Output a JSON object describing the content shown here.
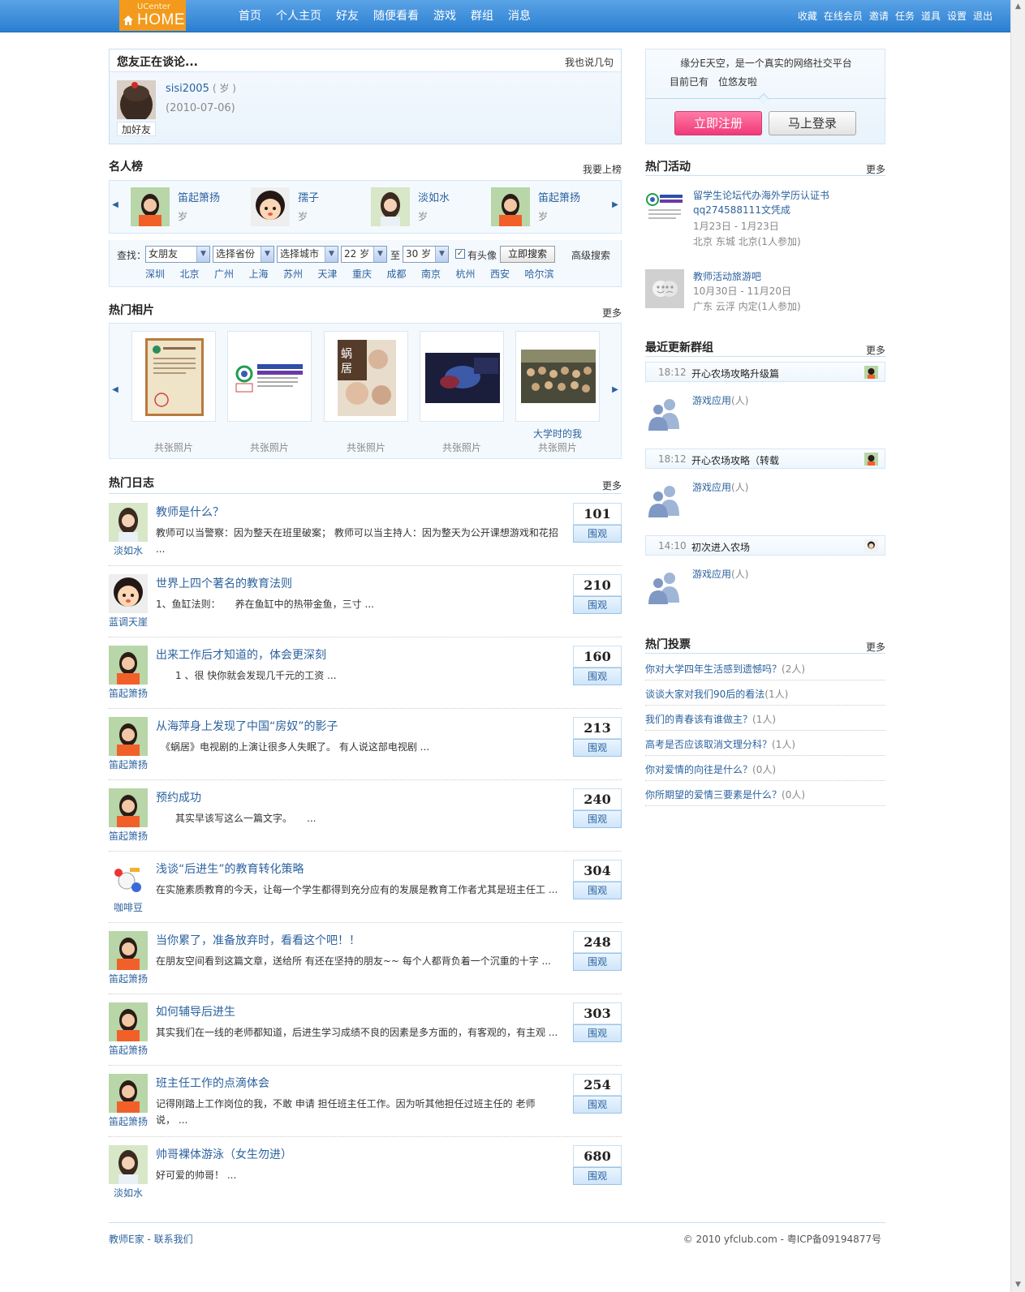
{
  "logo": {
    "uc": "UCenter",
    "home": "HOME"
  },
  "colors": {
    "topbar": "#2a7fd1",
    "logo": "#f39a1c",
    "link": "#2c629e",
    "register": "#f0397a"
  },
  "mainnav": [
    "首页",
    "个人主页",
    "好友",
    "随便看看",
    "游戏",
    "群组",
    "消息"
  ],
  "usernav": [
    "收藏",
    "在线会员",
    "邀请",
    "任务",
    "道具",
    "设置",
    "退出"
  ],
  "talk": {
    "title": "您友正在谈论...",
    "more": "我也说几句",
    "user": "sisi2005",
    "age": "( 岁 )",
    "date": "(2010-07-06)",
    "add_friend": "加好友"
  },
  "stars": {
    "title": "名人榜",
    "more": "我要上榜",
    "items": [
      {
        "name": "笛起箫扬",
        "age": "岁"
      },
      {
        "name": "孺子",
        "age": "岁"
      },
      {
        "name": "淡如水",
        "age": "岁"
      },
      {
        "name": "笛起箫扬",
        "age": "岁"
      }
    ]
  },
  "search": {
    "label": "查找：",
    "gender": "女朋友",
    "province": "选择省份",
    "city": "选择城市",
    "age_from": "22 岁",
    "to": "至",
    "age_to": "30 岁",
    "has_avatar": "有头像",
    "button": "立即搜索",
    "advanced": "高级搜索",
    "cities": [
      "深圳",
      "北京",
      "广州",
      "上海",
      "苏州",
      "天津",
      "重庆",
      "成都",
      "南京",
      "杭州",
      "西安",
      "哈尔滨"
    ]
  },
  "photos": {
    "title": "热门相片",
    "more": "更多",
    "items": [
      {
        "caption": "",
        "count": "共张照片"
      },
      {
        "caption": "",
        "count": "共张照片"
      },
      {
        "caption": "",
        "count": "共张照片"
      },
      {
        "caption": "",
        "count": "共张照片"
      },
      {
        "caption": "大学时的我",
        "count": "共张照片"
      }
    ]
  },
  "blogs": {
    "title": "热门日志",
    "more": "更多",
    "view_label": "围观",
    "items": [
      {
        "author": "淡如水",
        "title": "教师是什么？",
        "summary": "教师可以当警察：因为整天在班里破案； 教师可以当主持人：因为整天为公开课想游戏和花招 ...",
        "count": "101"
      },
      {
        "author": "蓝调天崖",
        "title": "世界上四个著名的教育法则",
        "summary": "1、鱼缸法则：　　养在鱼缸中的热带金鱼，三寸 ...",
        "count": "210"
      },
      {
        "author": "笛起箫扬",
        "title": "出来工作后才知道的，体会更深刻",
        "summary": "　　1 、很 快你就会发现几千元的工资 ...",
        "count": "160"
      },
      {
        "author": "笛起箫扬",
        "title": "从海萍身上发现了中国“房奴”的影子",
        "summary": "　《蜗居》电视剧的上演让很多人失眠了。 有人说这部电视剧 ...",
        "count": "213"
      },
      {
        "author": "笛起箫扬",
        "title": "预约成功",
        "summary": "　　其实早该写这么一篇文字。　　...",
        "count": "240"
      },
      {
        "author": "咖啡豆",
        "title": "浅谈“后进生”的教育转化策略",
        "summary": "在实施素质教育的今天，让每一个学生都得到充分应有的发展是教育工作者尤其是班主任工 ...",
        "count": "304"
      },
      {
        "author": "笛起箫扬",
        "title": "当你累了，准备放弃时，看看这个吧！！",
        "summary": "在朋友空间看到这篇文章，送给所 有还在坚持的朋友~~ 每个人都背负着一个沉重的十字 ...",
        "count": "248"
      },
      {
        "author": "笛起箫扬",
        "title": "如何辅导后进生",
        "summary": "其实我们在一线的老师都知道，后进生学习成绩不良的因素是多方面的，有客观的，有主观 ...",
        "count": "303"
      },
      {
        "author": "笛起箫扬",
        "title": "班主任工作的点滴体会",
        "summary": "记得刚踏上工作岗位的我，不敢 申请 担任班主任工作。因为听其他担任过班主任的 老师说， ...",
        "count": "254"
      },
      {
        "author": "淡如水",
        "title": "帅哥裸体游泳（女生勿进）",
        "summary": "好可爱的帅哥！ ...",
        "count": "680"
      }
    ]
  },
  "welcome": {
    "slogan": "缘分E天空，是一个真实的网络社交平台",
    "online": "目前已有　位悠友啦",
    "register": "立即注册",
    "login": "马上登录"
  },
  "events": {
    "title": "热门活动",
    "more": "更多",
    "items": [
      {
        "title": "留学生论坛代办海外学历认证书qq274588111文凭成",
        "time": "1月23日 - 1月23日",
        "place": "北京 东城 北京(1人参加)"
      },
      {
        "title": "教师活动旅游吧",
        "time": "10月30日 - 11月20日",
        "place": "广东 云浮 内定(1人参加)"
      }
    ]
  },
  "groups": {
    "title": "最近更新群组",
    "more": "更多",
    "items": [
      {
        "time": "18:12",
        "title": "开心农场攻略升级篇",
        "app": "游戏应用",
        "members": "(人)"
      },
      {
        "time": "18:12",
        "title": "开心农场攻略（转载",
        "app": "游戏应用",
        "members": "(人)"
      },
      {
        "time": "14:10",
        "title": "初次进入农场",
        "app": "游戏应用",
        "members": "(人)"
      }
    ]
  },
  "polls": {
    "title": "热门投票",
    "more": "更多",
    "items": [
      {
        "text": "你对大学四年生活感到遗憾吗？",
        "count": "(2人)"
      },
      {
        "text": "谈谈大家对我们90后的看法",
        "count": "(1人)"
      },
      {
        "text": "我们的青春该有谁做主？",
        "count": "(1人)"
      },
      {
        "text": "高考是否应该取消文理分科？",
        "count": "(1人)"
      },
      {
        "text": "你对爱情的向往是什么？",
        "count": "(0人)"
      },
      {
        "text": "你所期望的爱情三要素是什么？",
        "count": "(0人)"
      }
    ]
  },
  "footer": {
    "site": "教师E家",
    "sep": " - ",
    "contact": "联系我们",
    "copyright": "© 2010 yfclub.com - 粤ICP备09194877号"
  }
}
